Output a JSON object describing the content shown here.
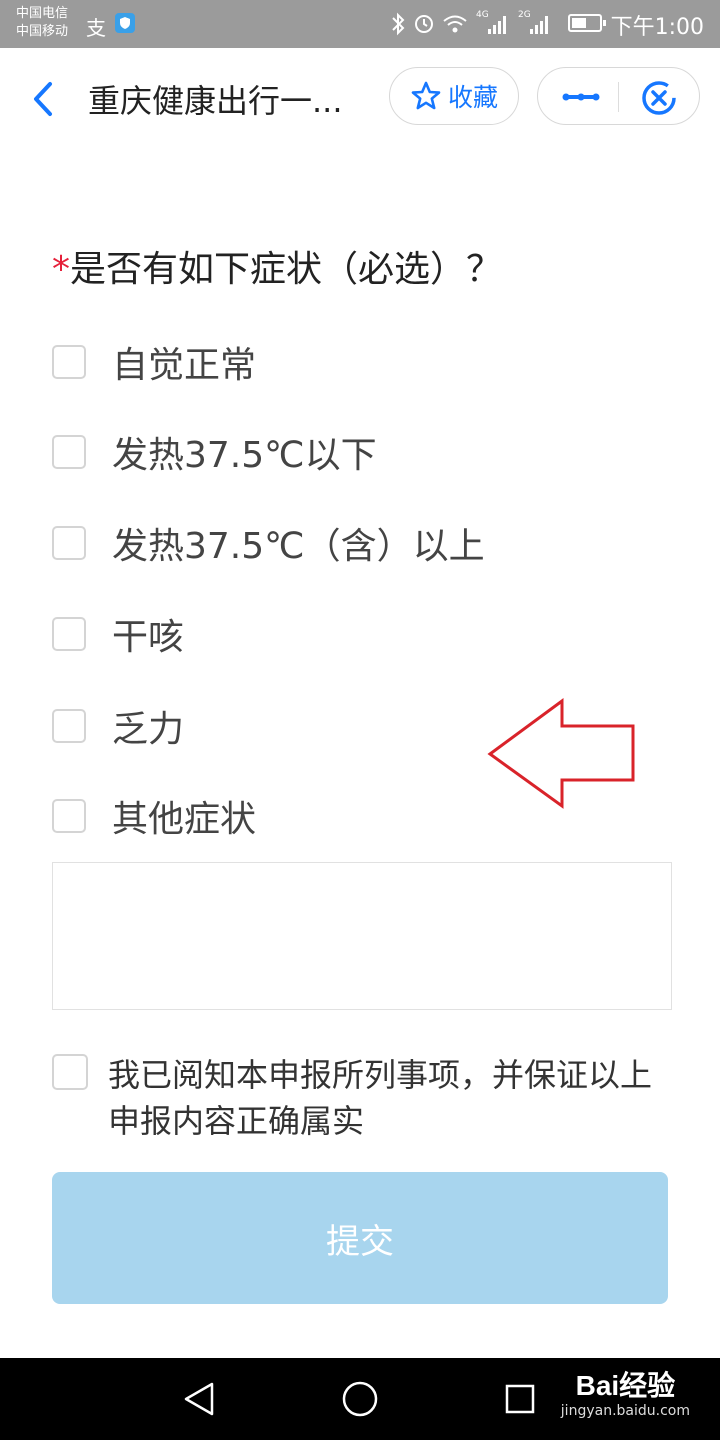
{
  "status_bar": {
    "carrier_1": "中国电信",
    "carrier_2": "中国移动",
    "net_tag_1": "4G",
    "net_tag_2": "2G",
    "battery_level": 0.55,
    "time": "下午1:00"
  },
  "header": {
    "title": "重庆健康出行一...",
    "favorite_label": "收藏",
    "accent": "#1677ff"
  },
  "form": {
    "required_mark": "*",
    "question": "是否有如下症状（必选）？",
    "options": [
      {
        "label": "自觉正常"
      },
      {
        "label": "发热37.5℃以下"
      },
      {
        "label": "发热37.5℃（含）以上"
      },
      {
        "label": "干咳"
      },
      {
        "label": "乏力"
      },
      {
        "label": "其他症状"
      }
    ],
    "other_text_value": "",
    "agree_text": "我已阅知本申报所列事项，并保证以上申报内容正确属实",
    "submit_label": "提交"
  },
  "watermark": {
    "brand": "Bai经验",
    "url": "jingyan.baidu.com"
  }
}
